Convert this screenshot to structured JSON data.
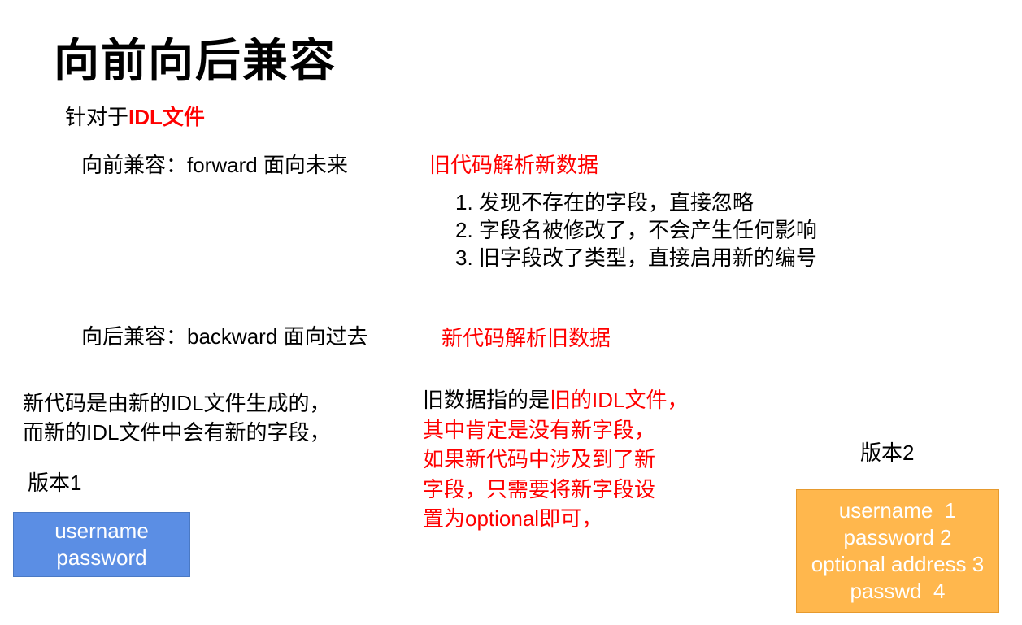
{
  "title": "向前向后兼容",
  "intro": {
    "prefix": "针对于",
    "highlight": "IDL文件"
  },
  "forward": {
    "label": "向前兼容：forward 面向未来",
    "note": "旧代码解析新数据",
    "items": [
      "1. 发现不存在的字段，直接忽略",
      "2. 字段名被修改了，不会产生任何影响",
      "3. 旧字段改了类型，直接启用新的编号"
    ]
  },
  "backward": {
    "label": "向后兼容：backward 面向过去",
    "note": "新代码解析旧数据"
  },
  "left_text": {
    "line1": "新代码是由新的IDL文件生成的，",
    "line2": "而新的IDL文件中会有新的字段，"
  },
  "middle_text": {
    "line1_prefix": "旧数据指的是",
    "line1_highlight": "旧的IDL文件，",
    "line2": "其中肯定是没有新字段，",
    "line3": "如果新代码中涉及到了新",
    "line4": "字段，只需要将新字段设",
    "line5": "置为optional即可，"
  },
  "version1": {
    "label": "版本1",
    "fields": [
      "username",
      "password"
    ]
  },
  "version2": {
    "label": "版本2",
    "fields": [
      "username  1",
      "password 2",
      "optional address 3",
      "passwd  4"
    ]
  },
  "colors": {
    "red": "#ff0000",
    "blue_box": "#5b8ee4",
    "orange_box": "#ffb74d"
  }
}
